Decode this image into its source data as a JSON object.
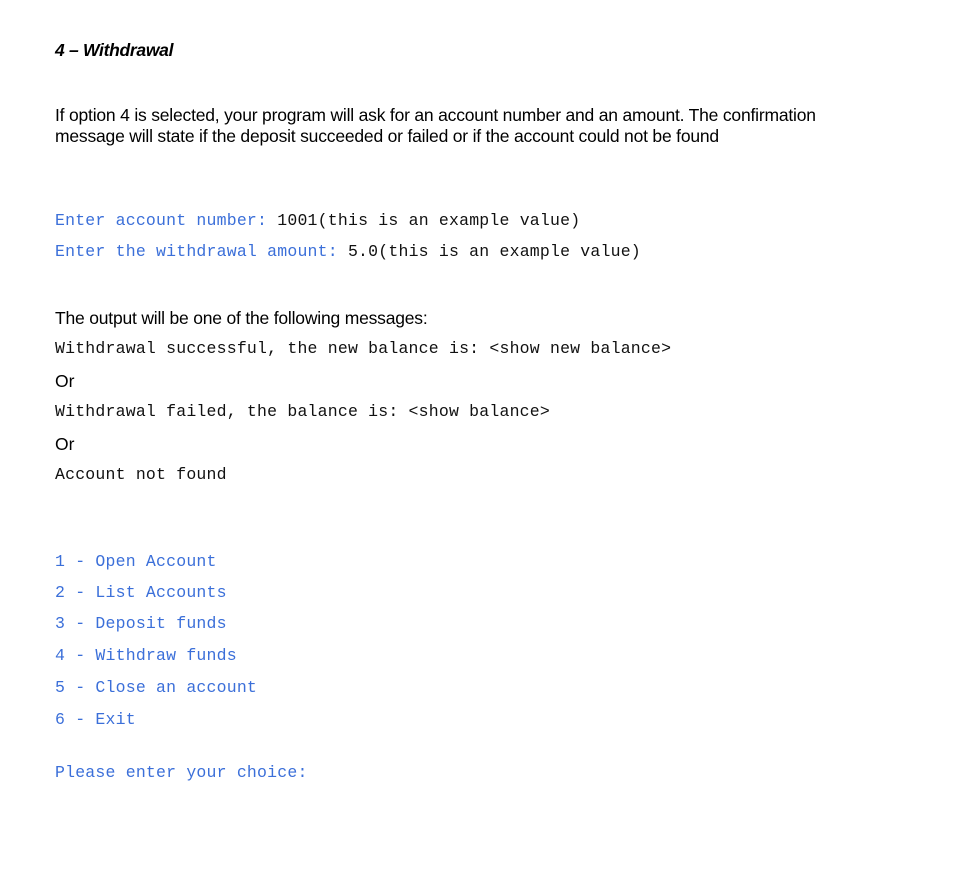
{
  "section": {
    "heading": "4 – Withdrawal",
    "intro": "If option 4 is selected, your program will ask for an account number and an amount. The confirmation message will state if the deposit succeeded or failed or if the account could not be found"
  },
  "prompts": [
    {
      "label": "Enter account number: ",
      "value": "1001",
      "note": "(this is an example value)"
    },
    {
      "label": "Enter the withdrawal amount: ",
      "value": "5.0",
      "note": "(this is an example value)"
    }
  ],
  "outputs": {
    "heading": "The output will be one of the following messages:",
    "success": "Withdrawal successful, the new balance is: <show new balance>",
    "or_1": "Or",
    "failed": "Withdrawal failed, the balance is: <show balance>",
    "or_2": "Or",
    "not_found": "Account not found"
  },
  "menu": {
    "items": [
      "1 - Open Account",
      "2 - List Accounts",
      "3 - Deposit funds",
      "4 - Withdraw funds",
      "5 - Close an account",
      "6 - Exit"
    ],
    "choice_prompt": "Please enter your choice:"
  },
  "colors": {
    "console_blue": "#3b6fd9",
    "console_black": "#111111",
    "text": "#000000"
  }
}
